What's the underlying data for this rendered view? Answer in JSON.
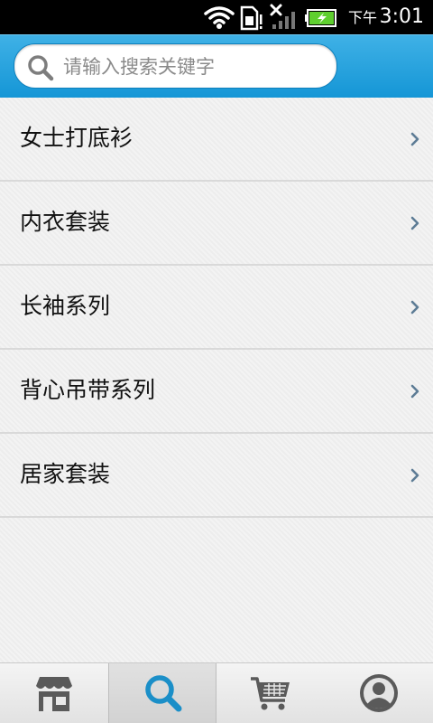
{
  "status_bar": {
    "ampm": "下午",
    "time": "3:01",
    "icons": [
      "wifi-icon",
      "sim-card-icon",
      "no-signal-icon",
      "battery-charging-icon"
    ]
  },
  "search": {
    "placeholder": "请输入搜索关键字",
    "icon": "search-icon"
  },
  "categories": [
    {
      "label": "女士打底衫"
    },
    {
      "label": "内衣套装"
    },
    {
      "label": "长袖系列"
    },
    {
      "label": "背心吊带系列"
    },
    {
      "label": "居家套装"
    }
  ],
  "tabbar": {
    "active_index": 1,
    "tabs": [
      {
        "icon": "store-icon"
      },
      {
        "icon": "search-icon"
      },
      {
        "icon": "shopping-cart-icon"
      },
      {
        "icon": "user-account-icon"
      }
    ]
  },
  "colors": {
    "header_blue": "#1ea3df",
    "active_tab_icon": "#1b8fc8",
    "inactive_tab_icon": "#595959"
  }
}
